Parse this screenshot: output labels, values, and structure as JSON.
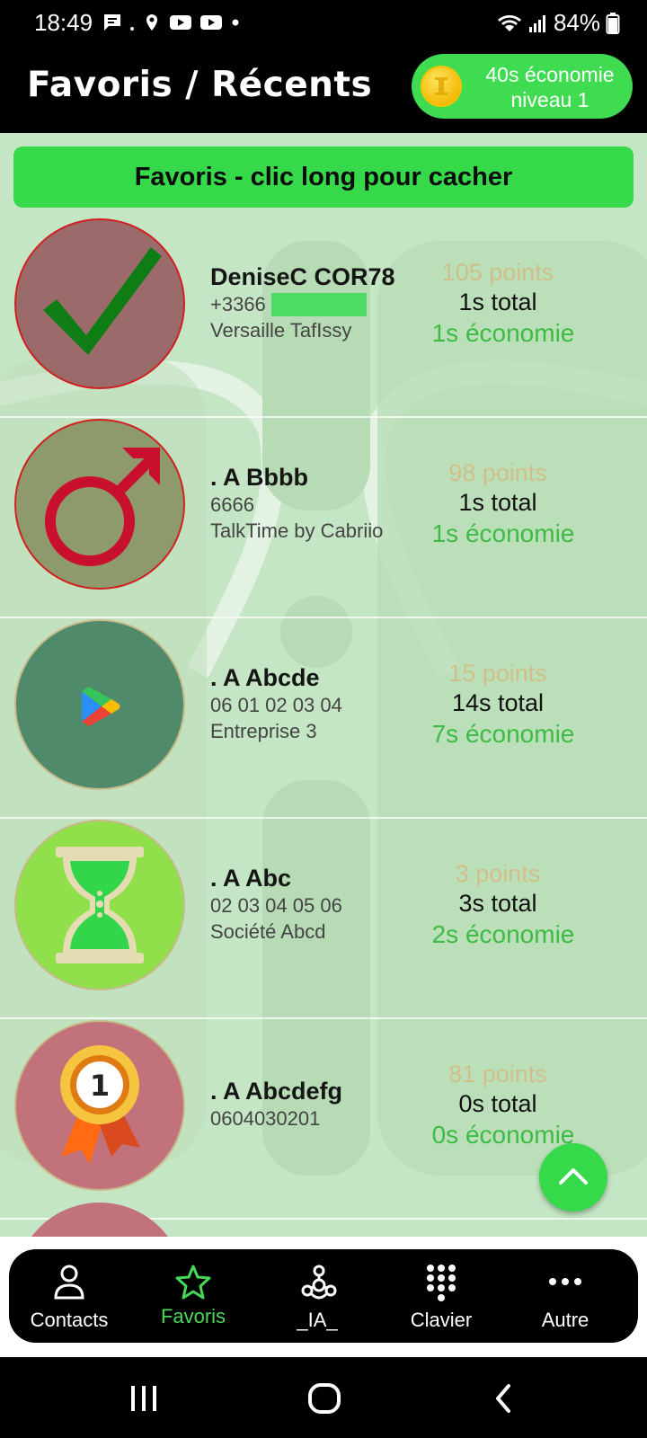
{
  "status_bar": {
    "time": "18:49",
    "battery": "84%",
    "icons": [
      "chat-icon",
      "location-icon",
      "youtube-icon",
      "youtube-icon",
      "dot-icon",
      "wifi-icon",
      "signal-icon",
      "battery-icon"
    ]
  },
  "header": {
    "title": "Favoris / Récents",
    "savings_line1": "40s économie",
    "savings_line2": "niveau 1"
  },
  "section": {
    "banner": "Favoris - clic long pour cacher"
  },
  "contacts": [
    {
      "name": "DeniseC COR78",
      "phone": "+3366",
      "org": "Versaille TafIssy",
      "points": "105 points",
      "total": "1s total",
      "economy": "1s économie",
      "avatar": "checkmark-icon"
    },
    {
      "name": ". A Bbbb",
      "phone": "6666",
      "org": "TalkTime by Cabriio",
      "points": "98 points",
      "total": "1s total",
      "economy": "1s économie",
      "avatar": "male-symbol-icon"
    },
    {
      "name": ". A Abcde",
      "phone": "06 01 02 03 04",
      "org": "Entreprise 3",
      "points": "15 points",
      "total": "14s total",
      "economy": "7s économie",
      "avatar": "play-store-icon"
    },
    {
      "name": ". A Abc",
      "phone": "02 03 04 05 06",
      "org": "Société Abcd",
      "points": "3 points",
      "total": "3s total",
      "economy": "2s économie",
      "avatar": "hourglass-icon"
    },
    {
      "name": ". A Abcdefg",
      "phone": "0604030201",
      "org": "",
      "points": "81 points",
      "total": "0s total",
      "economy": "0s économie",
      "avatar": "medal-icon"
    }
  ],
  "nav": {
    "items": [
      {
        "label": "Contacts",
        "icon": "person-icon"
      },
      {
        "label": "Favoris",
        "icon": "star-icon",
        "active": true
      },
      {
        "label": "_IA_",
        "icon": "ai-icon"
      },
      {
        "label": "Clavier",
        "icon": "dialpad-icon"
      },
      {
        "label": "Autre",
        "icon": "more-icon"
      }
    ]
  },
  "colors": {
    "accent": "#35d94a",
    "background": "#c5e6c4",
    "points": "#cfc08a",
    "economy": "#3dbb44"
  }
}
